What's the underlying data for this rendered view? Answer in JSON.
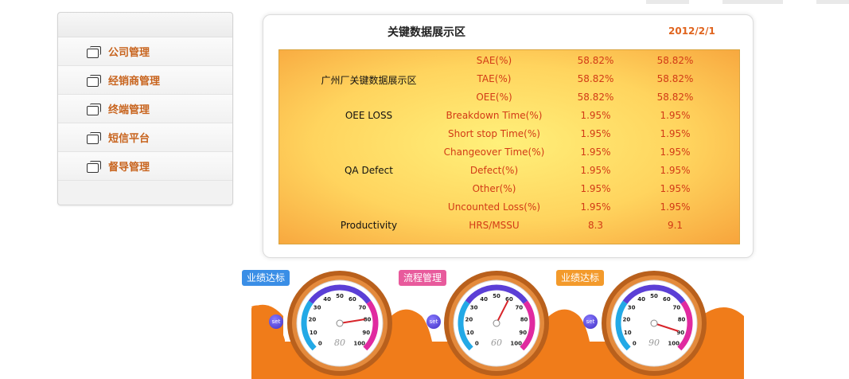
{
  "sidebar": {
    "items": [
      {
        "label": "公司管理"
      },
      {
        "label": "经销商管理"
      },
      {
        "label": "终端管理"
      },
      {
        "label": "短信平台"
      },
      {
        "label": "督导管理"
      }
    ]
  },
  "panel": {
    "title": "关键数据展示区",
    "date": "2012/2/1",
    "rows": [
      {
        "group": "",
        "metric": "SAE(%)",
        "v1": "58.82%",
        "v2": "58.82%"
      },
      {
        "group": "广州厂关键数据展示区",
        "metric": "TAE(%)",
        "v1": "58.82%",
        "v2": "58.82%"
      },
      {
        "group": "",
        "metric": "OEE(%)",
        "v1": "58.82%",
        "v2": "58.82%"
      },
      {
        "group": "OEE LOSS",
        "metric": "Breakdown Time(%)",
        "v1": "1.95%",
        "v2": "1.95%"
      },
      {
        "group": "",
        "metric": "Short stop Time(%)",
        "v1": "1.95%",
        "v2": "1.95%"
      },
      {
        "group": "",
        "metric": "Changeover Time(%)",
        "v1": "1.95%",
        "v2": "1.95%"
      },
      {
        "group": "QA Defect",
        "metric": "Defect(%)",
        "v1": "1.95%",
        "v2": "1.95%"
      },
      {
        "group": "",
        "metric": "Other(%)",
        "v1": "1.95%",
        "v2": "1.95%"
      },
      {
        "group": "",
        "metric": "Uncounted Loss(%)",
        "v1": "1.95%",
        "v2": "1.95%"
      },
      {
        "group": "Productivity",
        "metric": "HRS/MSSU",
        "v1": "8.3",
        "v2": "9.1"
      }
    ]
  },
  "gauges": [
    {
      "tag": "业绩达标",
      "tag_color": "#3a8ee6",
      "value": 80,
      "set_label": "set"
    },
    {
      "tag": "流程管理",
      "tag_color": "#e85a9c",
      "value": 60,
      "set_label": "set"
    },
    {
      "tag": "业绩达标",
      "tag_color": "#f39a2b",
      "value": 90,
      "set_label": "set"
    }
  ],
  "gauge_ticks": [
    "0",
    "10",
    "20",
    "30",
    "40",
    "50",
    "60",
    "70",
    "80",
    "90",
    "100"
  ],
  "colors": {
    "accent_orange": "#e0641e",
    "wave_orange": "#f07c1a",
    "metric_red": "#d23a16"
  }
}
